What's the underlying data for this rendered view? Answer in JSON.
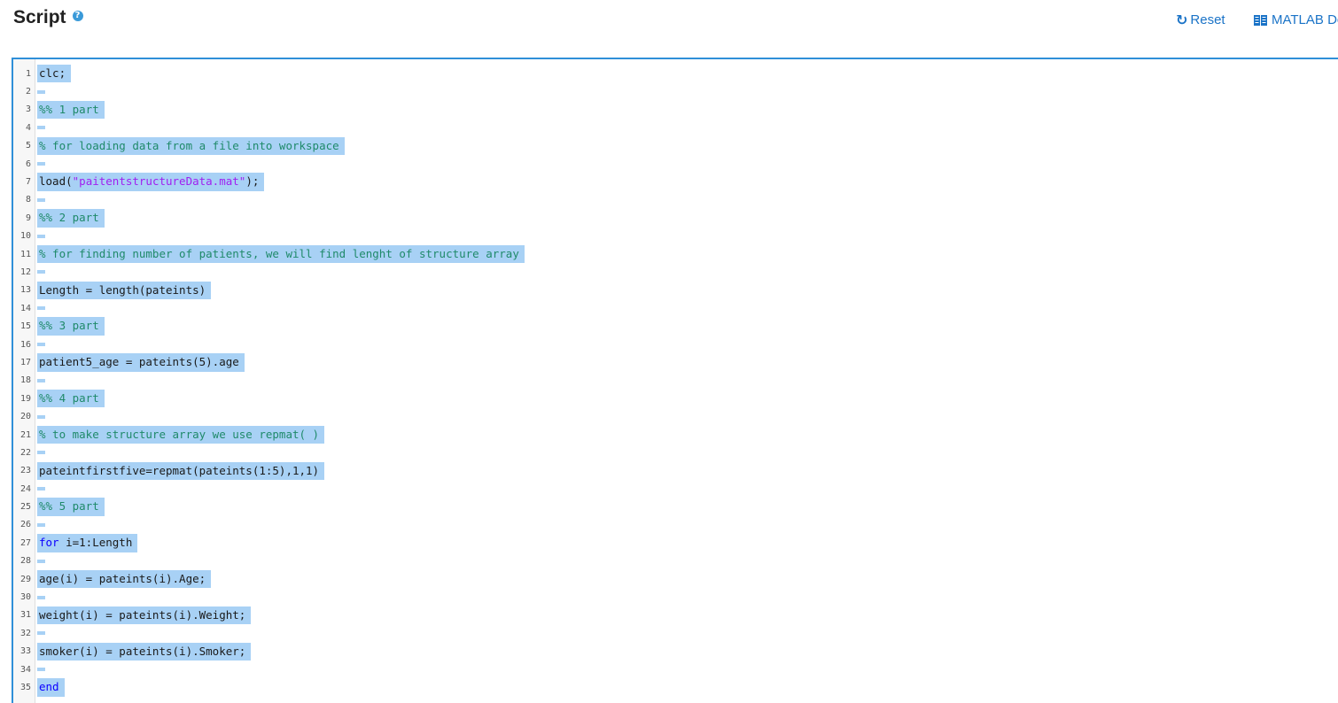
{
  "header": {
    "title": "Script",
    "help_icon": "?",
    "reset_label": "Reset",
    "matlab_label": "MATLAB Do"
  },
  "colors": {
    "accent": "#2f8fd8",
    "link": "#1a73c7",
    "selection": "#a8d1f5",
    "comment": "#1f8a6a",
    "string": "#a020f0",
    "keyword": "#0e00ff"
  },
  "icons": {
    "help": "question-circle-icon",
    "reset": "refresh-icon",
    "matlab": "book-icon"
  },
  "editor": {
    "lines": [
      {
        "n": "1",
        "text": "clc;"
      },
      {
        "n": "2",
        "text": ""
      },
      {
        "n": "3",
        "text": "%% 1 part"
      },
      {
        "n": "4",
        "text": ""
      },
      {
        "n": "5",
        "text": "% for loading data from a file into workspace"
      },
      {
        "n": "6",
        "text": ""
      },
      {
        "n": "7",
        "pre": "load(",
        "str": "\"paitentstructureData.mat\"",
        "post": ");"
      },
      {
        "n": "8",
        "text": ""
      },
      {
        "n": "9",
        "text": "%% 2 part"
      },
      {
        "n": "10",
        "text": ""
      },
      {
        "n": "11",
        "text": "% for finding number of patients, we will find lenght of structure array"
      },
      {
        "n": "12",
        "text": ""
      },
      {
        "n": "13",
        "text": "Length = length(pateints)"
      },
      {
        "n": "14",
        "text": ""
      },
      {
        "n": "15",
        "text": "%% 3 part"
      },
      {
        "n": "16",
        "text": ""
      },
      {
        "n": "17",
        "text": "patient5_age = pateints(5).age"
      },
      {
        "n": "18",
        "text": ""
      },
      {
        "n": "19",
        "text": "%% 4 part"
      },
      {
        "n": "20",
        "text": ""
      },
      {
        "n": "21",
        "text": "% to make structure array we use repmat( )"
      },
      {
        "n": "22",
        "text": ""
      },
      {
        "n": "23",
        "text": "pateintfirstfive=repmat(pateints(1:5),1,1)"
      },
      {
        "n": "24",
        "text": ""
      },
      {
        "n": "25",
        "text": "%% 5 part"
      },
      {
        "n": "26",
        "text": ""
      },
      {
        "n": "27",
        "kw": "for",
        "post": " i=1:Length"
      },
      {
        "n": "28",
        "text": ""
      },
      {
        "n": "29",
        "text": "age(i) = pateints(i).Age;"
      },
      {
        "n": "30",
        "text": ""
      },
      {
        "n": "31",
        "text": "weight(i) = pateints(i).Weight;"
      },
      {
        "n": "32",
        "text": ""
      },
      {
        "n": "33",
        "text": "smoker(i) = pateints(i).Smoker;"
      },
      {
        "n": "34",
        "text": ""
      },
      {
        "n": "35",
        "kw": "end"
      }
    ]
  }
}
